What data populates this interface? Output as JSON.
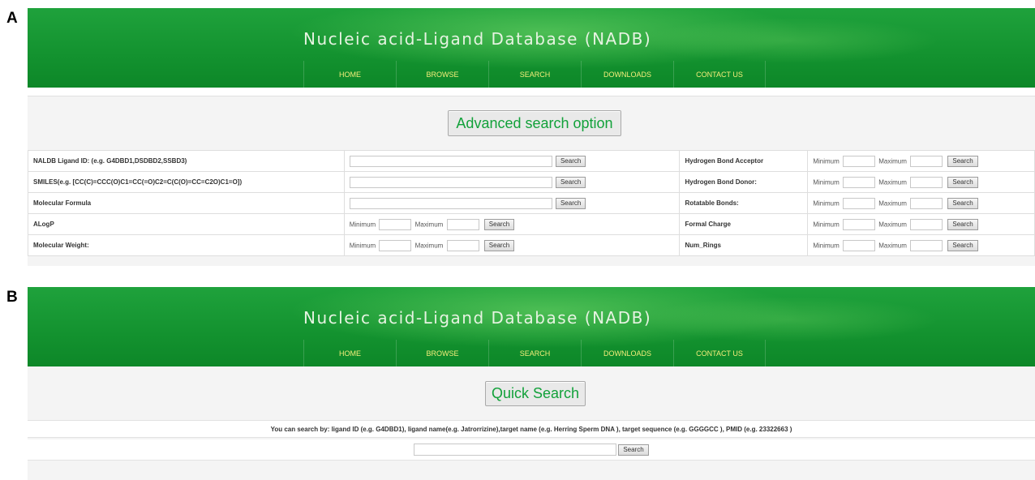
{
  "panel_labels": {
    "a": "A",
    "b": "B"
  },
  "site": {
    "title": "Nucleic acid-Ligand Database (NADB)",
    "nav": [
      "HOME",
      "BROWSE",
      "SEARCH",
      "DOWNLOADS",
      "CONTACT US"
    ],
    "colors": {
      "banner": "#13922f",
      "nav_text": "#f4ee7a",
      "button_text": "#12a13a"
    }
  },
  "advanced": {
    "header_button": "Advanced search option",
    "search_label": "Search",
    "minimum_label": "Minimum",
    "maximum_label": "Maximum",
    "left_fields": [
      "NALDB Ligand ID: (e.g. G4DBD1,DSDBD2,SSBD3)",
      "SMILES(e.g. [CC(C)=CCC(O)C1=CC(=O)C2=C(C(O)=CC=C2O)C1=O])",
      "Molecular Formula",
      "ALogP",
      "Molecular Weight:"
    ],
    "right_fields": [
      "Hydrogen Bond Acceptor",
      "Hydrogen Bond Donor:",
      "Rotatable Bonds:",
      "Formal Charge",
      "Num_Rings"
    ]
  },
  "quick": {
    "header_button": "Quick Search",
    "hint": "You can search by: ligand ID (e.g. G4DBD1), ligand name(e.g. Jatrorrizine),target name (e.g. Herring Sperm DNA ), target sequence (e.g. GGGGCC ), PMID (e.g. 23322663 )",
    "search_label": "Search"
  }
}
